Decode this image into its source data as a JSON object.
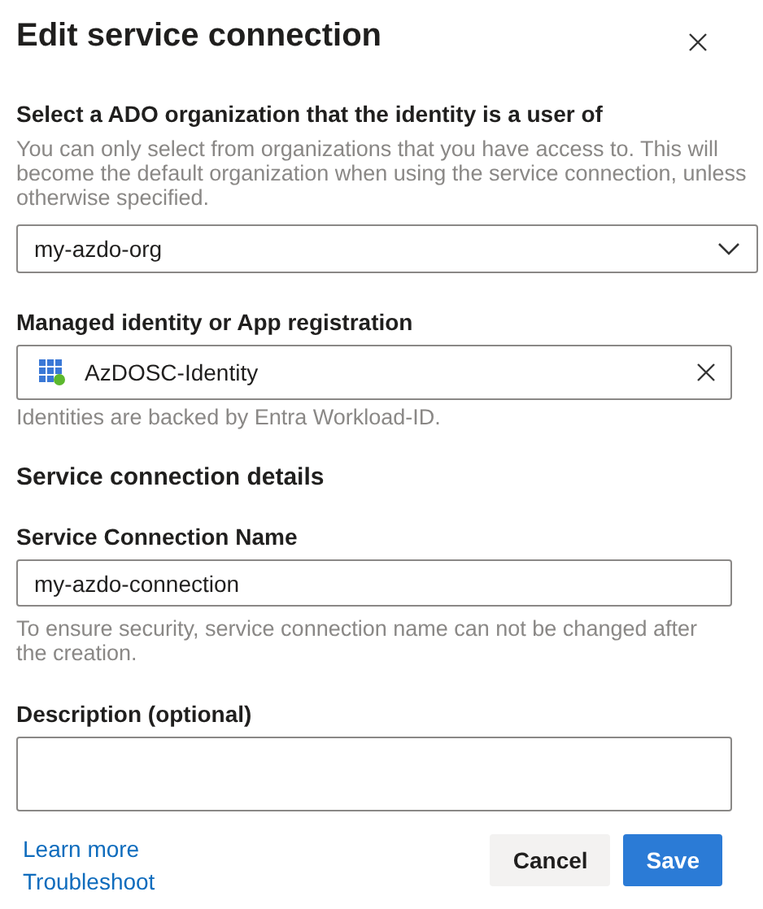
{
  "dialog": {
    "title": "Edit service connection"
  },
  "organization": {
    "label": "Select a ADO organization that the identity is a user of",
    "help": "You can only select from organizations that you have access to. This will become the default organization when using the service connection, unless otherwise specified.",
    "value": "my-azdo-org"
  },
  "identity": {
    "label": "Managed identity or App registration",
    "value": "AzDOSC-Identity",
    "help": "Identities are backed by Entra Workload-ID."
  },
  "section": {
    "title": "Service connection details"
  },
  "connection_name": {
    "label": "Service Connection Name",
    "value": "my-azdo-connection",
    "help": "To ensure security, service connection name can not be changed after the creation."
  },
  "description": {
    "label": "Description (optional)"
  },
  "links": [
    "Learn more",
    "Troubleshoot"
  ],
  "buttons": [
    {
      "label": "Cancel",
      "kind": "secondary"
    },
    {
      "label": "Save",
      "kind": "primary"
    }
  ]
}
